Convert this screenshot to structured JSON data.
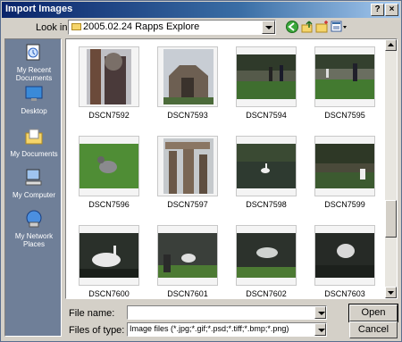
{
  "window": {
    "title": "Import Images"
  },
  "titlebar_buttons": {
    "help": "?",
    "close": "×"
  },
  "lookin": {
    "label": "Look in:",
    "value": "2005.02.24 Rapps Explore"
  },
  "places": [
    {
      "label": "My Recent Documents",
      "icon": "recent-documents-icon"
    },
    {
      "label": "Desktop",
      "icon": "desktop-icon"
    },
    {
      "label": "My Documents",
      "icon": "my-documents-icon"
    },
    {
      "label": "My Computer",
      "icon": "my-computer-icon"
    },
    {
      "label": "My Network Places",
      "icon": "network-places-icon"
    }
  ],
  "files": [
    {
      "name": "DSCN7592"
    },
    {
      "name": "DSCN7593"
    },
    {
      "name": "DSCN7594"
    },
    {
      "name": "DSCN7595"
    },
    {
      "name": "DSCN7596"
    },
    {
      "name": "DSCN7597"
    },
    {
      "name": "DSCN7598"
    },
    {
      "name": "DSCN7599"
    },
    {
      "name": "DSCN7600"
    },
    {
      "name": "DSCN7601"
    },
    {
      "name": "DSCN7602"
    },
    {
      "name": "DSCN7603"
    }
  ],
  "filename": {
    "label": "File name:",
    "value": ""
  },
  "filetype": {
    "label": "Files of type:",
    "value": "Image files (*.jpg;*.gif;*.psd;*.tiff;*.bmp;*.png)"
  },
  "buttons": {
    "open": "Open",
    "cancel": "Cancel"
  },
  "colors": {
    "title_bar": "#0a246a",
    "places_bar": "#6f7f98",
    "dialog_face": "#d4d0c8"
  }
}
